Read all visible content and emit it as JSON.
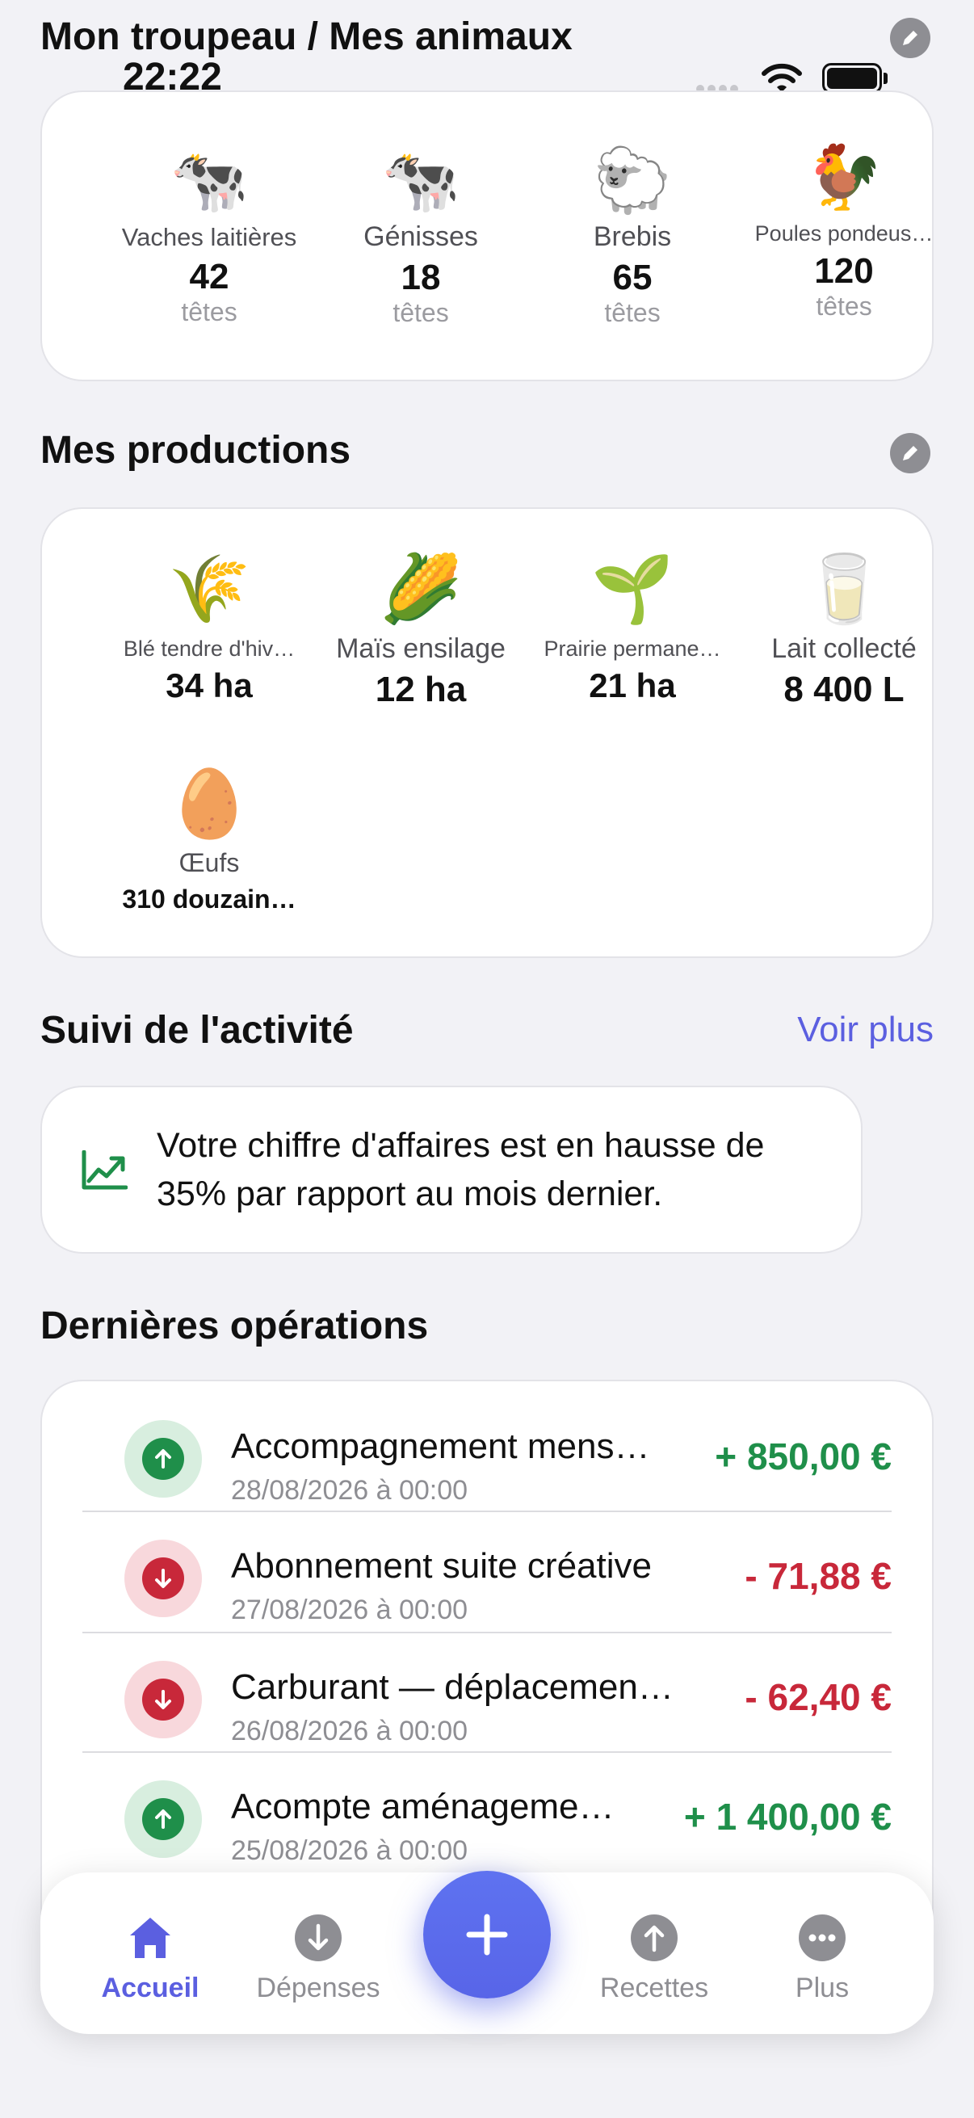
{
  "status_bar": {
    "time": "22:22"
  },
  "herd": {
    "title": "Mon troupeau / Mes animaux",
    "items": [
      {
        "emoji": "🐄",
        "label": "Vaches laitières",
        "value": "42",
        "unit": "têtes"
      },
      {
        "emoji": "🐄",
        "label": "Génisses",
        "value": "18",
        "unit": "têtes"
      },
      {
        "emoji": "🐑",
        "label": "Brebis",
        "value": "65",
        "unit": "têtes"
      },
      {
        "emoji": "🐓",
        "label": "Poules pondeus…",
        "value": "120",
        "unit": "têtes"
      }
    ]
  },
  "productions": {
    "title": "Mes productions",
    "items": [
      {
        "emoji": "🌾",
        "label": "Blé tendre d'hiv…",
        "value": "34 ha"
      },
      {
        "emoji": "🌽",
        "label": "Maïs ensilage",
        "value": "12 ha"
      },
      {
        "emoji": "🌱",
        "label": "Prairie permane…",
        "value": "21 ha"
      },
      {
        "emoji": "🥛",
        "label": "Lait collecté",
        "value": "8 400 L"
      },
      {
        "emoji": "🥚",
        "label": "Œufs",
        "value": "310 douzain…"
      }
    ]
  },
  "activity": {
    "title": "Suivi de l'activité",
    "see_more": "Voir plus",
    "insight": "Votre chiffre d'affaires est en hausse de 35% par rapport au mois dernier."
  },
  "operations": {
    "title": "Dernières opérations",
    "items": [
      {
        "title": "Accompagnement mens…",
        "date": "28/08/2026 à 00:00",
        "amount": "+ 850,00 €",
        "type": "income"
      },
      {
        "title": "Abonnement suite créative",
        "date": "27/08/2026 à 00:00",
        "amount": "- 71,88 €",
        "type": "expense"
      },
      {
        "title": "Carburant — déplacemen…",
        "date": "26/08/2026 à 00:00",
        "amount": "- 62,40 €",
        "type": "expense"
      },
      {
        "title": "Acompte aménageme…",
        "date": "25/08/2026 à 00:00",
        "amount": "+ 1 400,00 €",
        "type": "income"
      }
    ]
  },
  "tabbar": {
    "items": [
      {
        "label": "Accueil",
        "icon": "home-icon",
        "active": true
      },
      {
        "label": "Dépenses",
        "icon": "arrow-down-circle-icon",
        "active": false
      },
      {
        "label": "Recettes",
        "icon": "arrow-up-circle-icon",
        "active": false
      },
      {
        "label": "Plus",
        "icon": "more-icon",
        "active": false
      }
    ],
    "fab_icon": "plus-icon"
  },
  "colors": {
    "accent": "#5b5fe0",
    "income": "#1f8f4a",
    "expense": "#c8283a",
    "income_bg": "#d8eedf",
    "expense_bg": "#f8d8dc"
  }
}
